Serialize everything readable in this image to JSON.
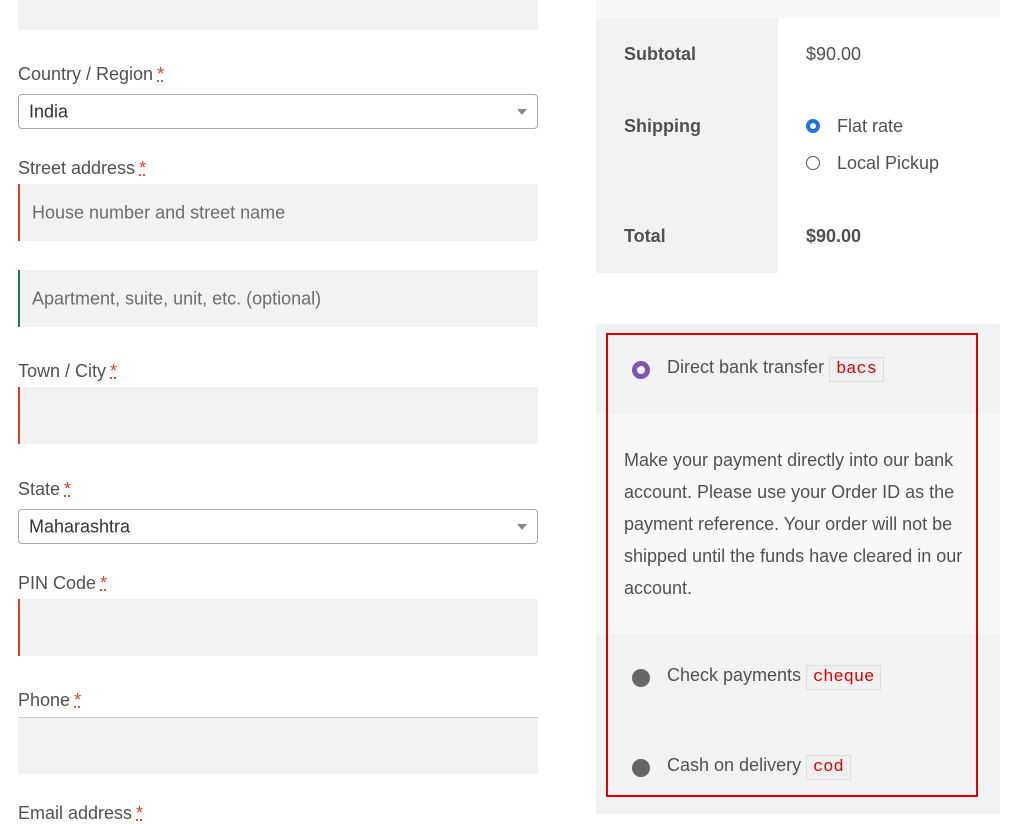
{
  "billing": {
    "country_label": "Country / Region",
    "country_value": "India",
    "street_label": "Street address",
    "street_placeholder": "House number and street name",
    "apartment_placeholder": "Apartment, suite, unit, etc. (optional)",
    "city_label": "Town / City",
    "state_label": "State",
    "state_value": "Maharashtra",
    "pin_label": "PIN Code",
    "phone_label": "Phone",
    "email_label": "Email address",
    "required_mark": "*"
  },
  "totals": {
    "subtotal_label": "Subtotal",
    "subtotal_value": "$90.00",
    "shipping_label": "Shipping",
    "shipping_options": [
      "Flat rate",
      "Local Pickup"
    ],
    "shipping_selected": "Flat rate",
    "total_label": "Total",
    "total_value": "$90.00"
  },
  "payment": {
    "methods": [
      {
        "label": "Direct bank transfer",
        "code": "bacs",
        "selected": true
      },
      {
        "label": "Check payments",
        "code": "cheque",
        "selected": false
      },
      {
        "label": "Cash on delivery",
        "code": "cod",
        "selected": false
      }
    ],
    "bacs_description": "Make your payment directly into our bank account. Please use your Order ID as the payment reference. Your order will not be shipped until the funds have cleared in our account."
  },
  "colors": {
    "error_border": "#e2401c",
    "valid_border": "#0f834d",
    "radio_selected": "#7f54b3",
    "highlight_box": "#e00000"
  }
}
